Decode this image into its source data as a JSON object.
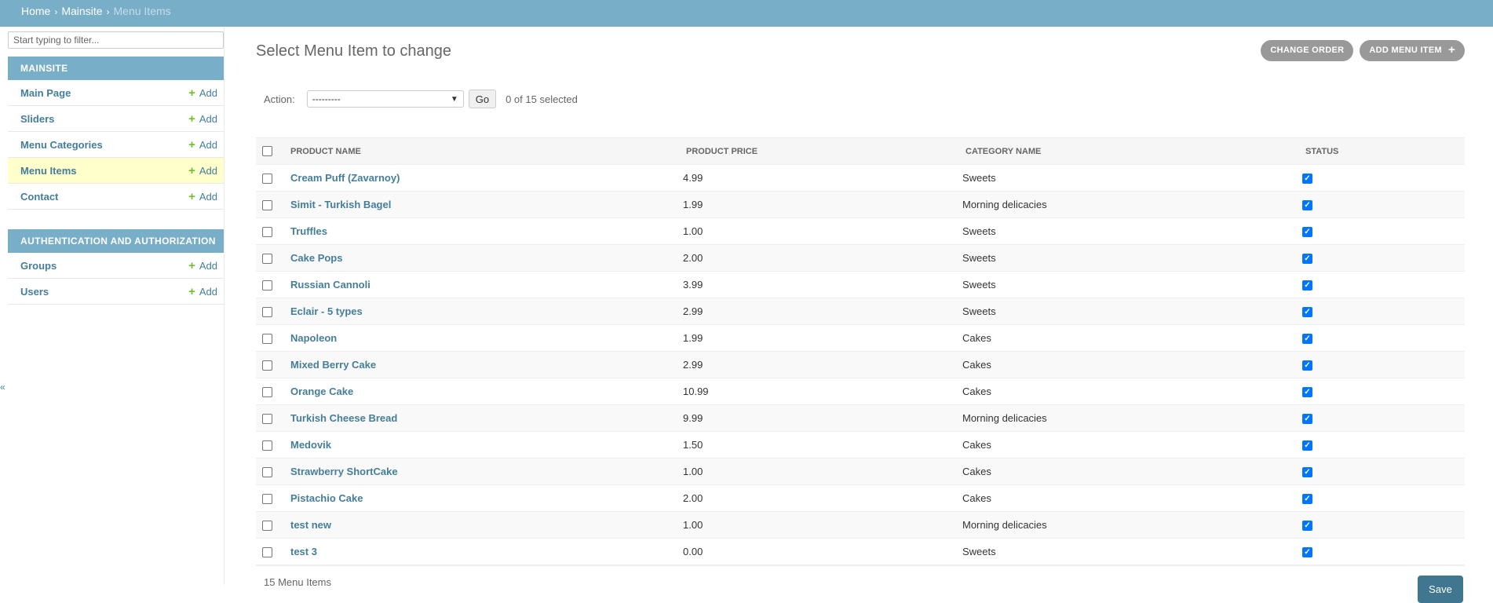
{
  "breadcrumb": {
    "home": "Home",
    "separator": "›",
    "app": "Mainsite",
    "current": "Menu Items"
  },
  "sidebar": {
    "filter_placeholder": "Start typing to filter...",
    "collapse_glyph": "«",
    "add_label": "Add",
    "modules": [
      {
        "caption": "Mainsite",
        "items": [
          {
            "label": "Main Page",
            "active": false
          },
          {
            "label": "Sliders",
            "active": false
          },
          {
            "label": "Menu Categories",
            "active": false
          },
          {
            "label": "Menu Items",
            "active": true
          },
          {
            "label": "Contact",
            "active": false
          }
        ]
      },
      {
        "caption": "Authentication and Authorization",
        "items": [
          {
            "label": "Groups",
            "active": false
          },
          {
            "label": "Users",
            "active": false
          }
        ]
      }
    ]
  },
  "main": {
    "title": "Select Menu Item to change",
    "tools": {
      "change_order": "Change order",
      "add_menu_item": "Add Menu Item"
    },
    "actions": {
      "label": "Action:",
      "select_value": "---------",
      "go": "Go",
      "selected": "0 of 15 selected"
    },
    "columns": [
      "Product name",
      "Product price",
      "Category name",
      "Status"
    ],
    "rows": [
      {
        "name": "Cream Puff (Zavarnoy)",
        "price": "4.99",
        "category": "Sweets",
        "status": true
      },
      {
        "name": "Simit - Turkish Bagel",
        "price": "1.99",
        "category": "Morning delicacies",
        "status": true
      },
      {
        "name": "Truffles",
        "price": "1.00",
        "category": "Sweets",
        "status": true
      },
      {
        "name": "Cake Pops",
        "price": "2.00",
        "category": "Sweets",
        "status": true
      },
      {
        "name": "Russian Cannoli",
        "price": "3.99",
        "category": "Sweets",
        "status": true
      },
      {
        "name": "Eclair - 5 types",
        "price": "2.99",
        "category": "Sweets",
        "status": true
      },
      {
        "name": "Napoleon",
        "price": "1.99",
        "category": "Cakes",
        "status": true
      },
      {
        "name": "Mixed Berry Cake",
        "price": "2.99",
        "category": "Cakes",
        "status": true
      },
      {
        "name": "Orange Cake",
        "price": "10.99",
        "category": "Cakes",
        "status": true
      },
      {
        "name": "Turkish Cheese Bread",
        "price": "9.99",
        "category": "Morning delicacies",
        "status": true
      },
      {
        "name": "Medovik",
        "price": "1.50",
        "category": "Cakes",
        "status": true
      },
      {
        "name": "Strawberry ShortCake",
        "price": "1.00",
        "category": "Cakes",
        "status": true
      },
      {
        "name": "Pistachio Cake",
        "price": "2.00",
        "category": "Cakes",
        "status": true
      },
      {
        "name": "test new",
        "price": "1.00",
        "category": "Morning delicacies",
        "status": true
      },
      {
        "name": "test 3",
        "price": "0.00",
        "category": "Sweets",
        "status": true
      }
    ],
    "paginator": "15 Menu Items",
    "save": "Save"
  },
  "colors": {
    "header": "#79aec8",
    "link": "#447e9b",
    "add_plus": "#70bf2b",
    "active_row": "#ffffcc",
    "save_button": "#417690",
    "checkbox_checked": "#0075ff"
  }
}
